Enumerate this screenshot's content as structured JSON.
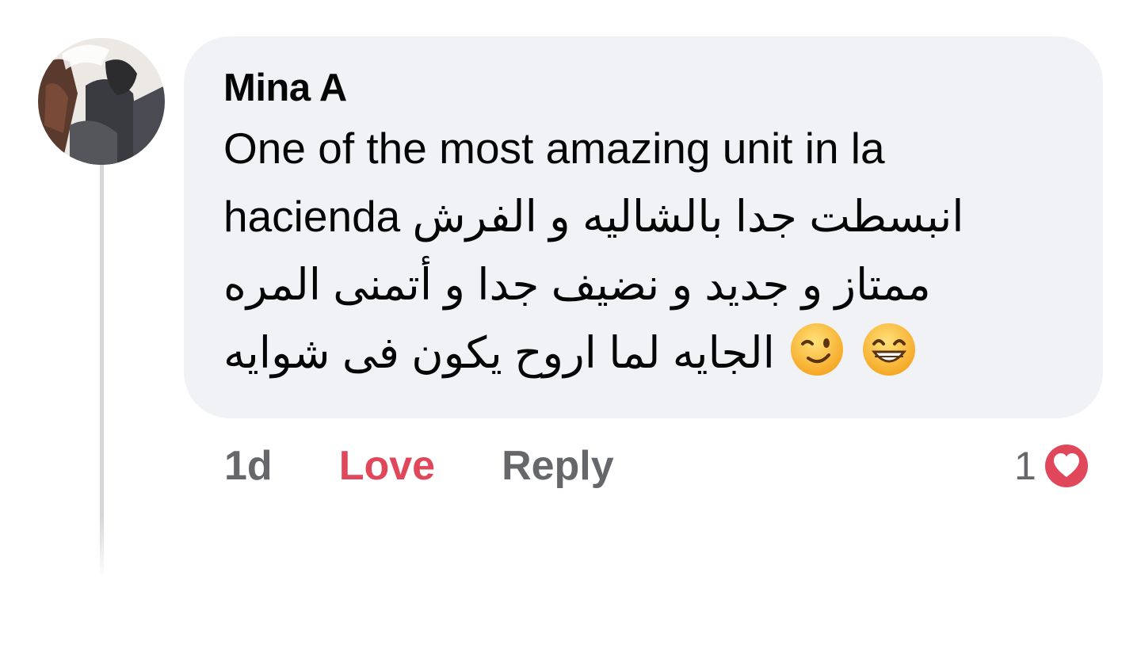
{
  "comment": {
    "author": "Mina A",
    "text_line1": "One of the most amazing unit in la",
    "text_latin": "hacienda",
    "text_arabic": "انبسطت جدا بالشاليه و الفرش ممتاز و جديد و نضيف جدا و أتمنى المره الجايه لما اروح يكون فى شوايه",
    "emojis": [
      "winking-face-icon",
      "grinning-face-icon"
    ]
  },
  "actions": {
    "time": "1d",
    "love_label": "Love",
    "reply_label": "Reply"
  },
  "reactions": {
    "count": "1",
    "icon": "heart-icon",
    "color": "#e0475b"
  },
  "colors": {
    "bubble": "#f0f2f5",
    "secondary_text": "#65676b",
    "love": "#e0475b"
  }
}
